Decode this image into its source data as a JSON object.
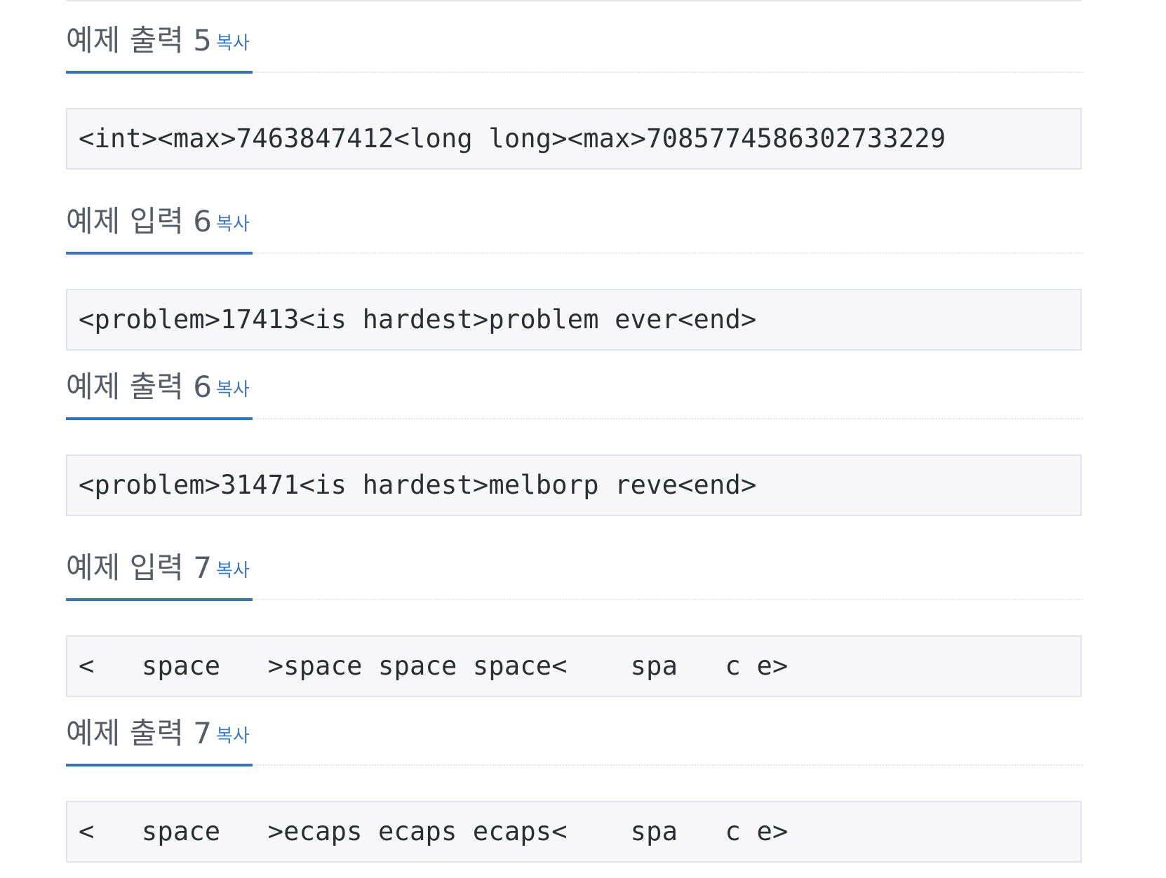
{
  "copy_label": "복사",
  "samples": [
    {
      "title": "예제 출력 5",
      "text": "<int><max>7463847412<long long><max>7085774586302733229"
    },
    {
      "title": "예제 입력 6",
      "text": "<problem>17413<is hardest>problem ever<end>"
    },
    {
      "title": "예제 출력 6",
      "text": "<problem>31471<is hardest>melborp reve<end>"
    },
    {
      "title": "예제 입력 7",
      "text": "<   space   >space space space<    spa   c e>"
    },
    {
      "title": "예제 출력 7",
      "text": "<   space   >ecaps ecaps ecaps<    spa   c e>"
    }
  ]
}
